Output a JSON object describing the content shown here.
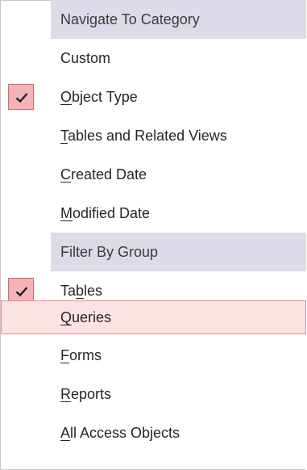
{
  "menu": {
    "sections": [
      {
        "header": "Navigate To Category",
        "items": [
          {
            "pre": "",
            "u": "",
            "post": "Custom",
            "checked": false
          },
          {
            "pre": "",
            "u": "O",
            "post": "bject Type",
            "checked": true
          },
          {
            "pre": "",
            "u": "T",
            "post": "ables and Related Views",
            "checked": false
          },
          {
            "pre": "",
            "u": "C",
            "post": "reated Date",
            "checked": false
          },
          {
            "pre": "",
            "u": "M",
            "post": "odified Date",
            "checked": false
          }
        ]
      },
      {
        "header": "Filter By Group",
        "items": [
          {
            "pre": "Ta",
            "u": "b",
            "post": "les",
            "checked": true
          },
          {
            "pre": "",
            "u": "Q",
            "post": "ueries",
            "checked": false,
            "hovered": true
          },
          {
            "pre": "",
            "u": "F",
            "post": "orms",
            "checked": false
          },
          {
            "pre": "",
            "u": "R",
            "post": "eports",
            "checked": false
          },
          {
            "pre": "",
            "u": "A",
            "post": "ll Access Objects",
            "checked": false
          }
        ]
      }
    ],
    "check_icon": "checkmark-icon",
    "colors": {
      "section_band": "#dcdce8",
      "check_bg": "#f3b4b6",
      "check_border": "#d8686d",
      "hover_bg": "#fbe3e4",
      "hover_border": "#e58a8f",
      "check_mark": "#1f1f1f"
    }
  }
}
